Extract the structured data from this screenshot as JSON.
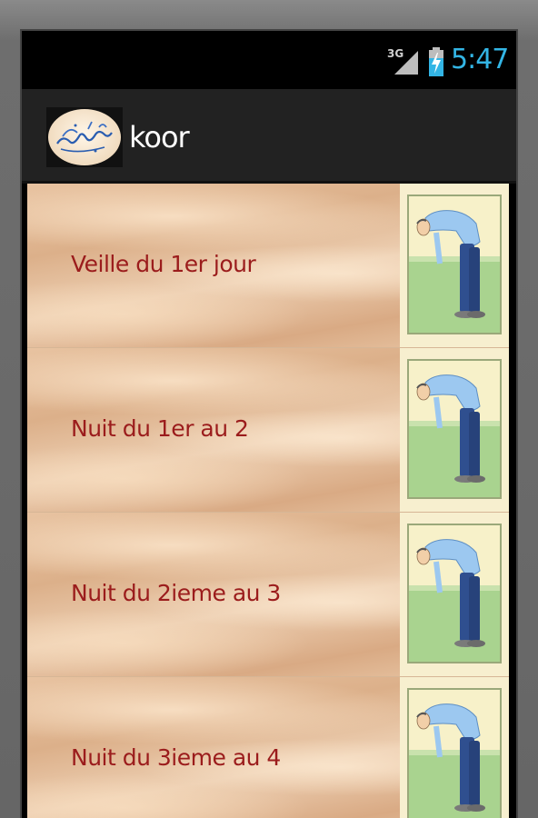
{
  "status_bar": {
    "network": "3G",
    "time": "5:47"
  },
  "action_bar": {
    "title": "koor"
  },
  "list_items": [
    {
      "label": "Veille du 1er jour"
    },
    {
      "label": "Nuit du 1er au 2"
    },
    {
      "label": "Nuit du 2ieme au 3"
    },
    {
      "label": "Nuit du 3ieme au 4"
    }
  ],
  "colors": {
    "time_accent": "#33b5e5",
    "label_red": "#9b1c1c",
    "action_bar_bg": "#222222"
  },
  "icons": {
    "app_icon": "ramadan-calligraphy-icon",
    "thumbnail": "bowing-man-icon"
  }
}
